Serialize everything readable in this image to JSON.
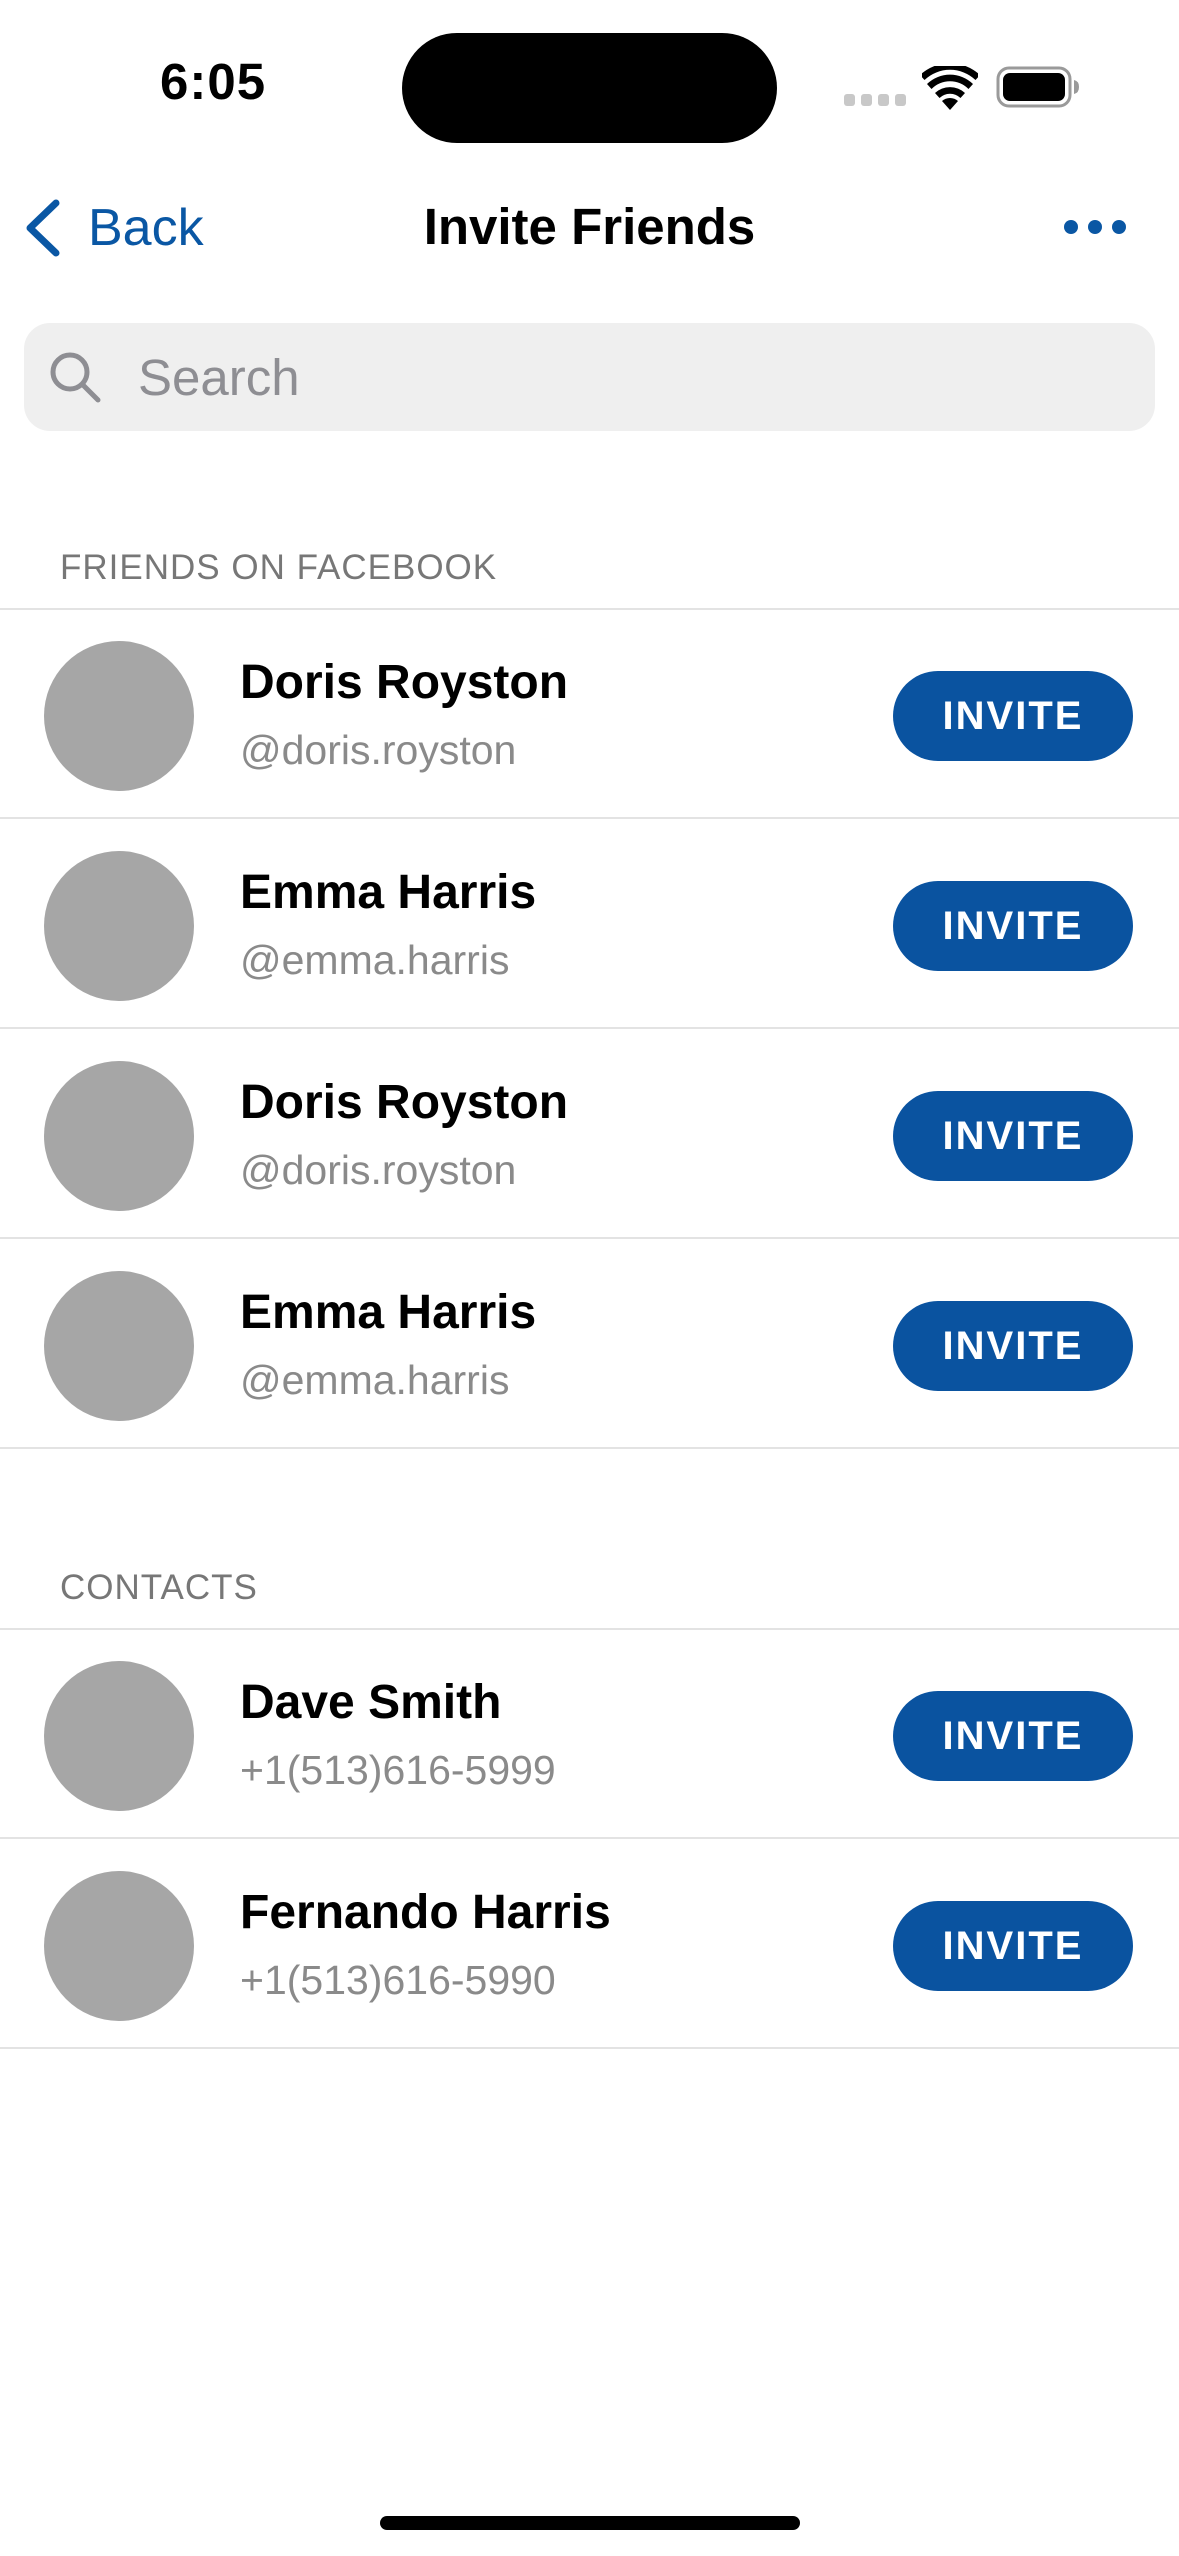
{
  "status_bar": {
    "time": "6:05"
  },
  "nav": {
    "back_label": "Back",
    "title": "Invite Friends"
  },
  "search": {
    "placeholder": "Search",
    "value": ""
  },
  "sections": {
    "facebook": {
      "header": "FRIENDS ON FACEBOOK",
      "items": [
        {
          "name": "Doris Royston",
          "sub": "@doris.royston",
          "action": "INVITE"
        },
        {
          "name": "Emma Harris",
          "sub": "@emma.harris",
          "action": "INVITE"
        },
        {
          "name": "Doris Royston",
          "sub": "@doris.royston",
          "action": "INVITE"
        },
        {
          "name": "Emma Harris",
          "sub": "@emma.harris",
          "action": "INVITE"
        }
      ]
    },
    "contacts": {
      "header": "CONTACTS",
      "items": [
        {
          "name": "Dave Smith",
          "sub": "+1(513)616-5999",
          "action": "INVITE"
        },
        {
          "name": "Fernando Harris",
          "sub": "+1(513)616-5990",
          "action": "INVITE"
        }
      ]
    }
  },
  "icons": {
    "back": "chevron-left-icon",
    "more": "ellipsis-icon",
    "search": "search-icon",
    "signal": "cellular-signal-icon",
    "wifi": "wifi-icon",
    "battery": "battery-icon"
  },
  "colors": {
    "accent": "#0A57A4",
    "invite_button": "#0A53A0",
    "avatar_placeholder": "#A6A6A6",
    "search_background": "#EFEFEF",
    "secondary_text": "#8A8A8A"
  }
}
